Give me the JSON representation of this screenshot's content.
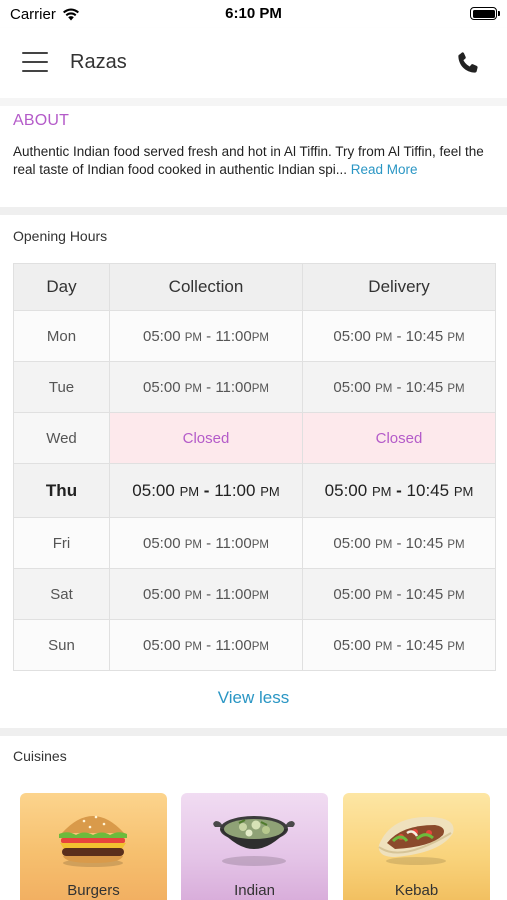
{
  "status_bar": {
    "carrier": "Carrier",
    "time": "6:10 PM"
  },
  "header": {
    "title": "Razas",
    "menu_icon": "hamburger-menu-icon",
    "phone_icon": "phone-icon"
  },
  "about": {
    "heading": "ABOUT",
    "text": "Authentic Indian food served fresh and hot in Al Tiffin. Try from Al Tiffin, feel the real taste of Indian food cooked in authentic Indian spi...",
    "read_more": "Read More"
  },
  "opening_hours": {
    "title": "Opening Hours",
    "headers": {
      "day": "Day",
      "collection": "Collection",
      "delivery": "Delivery"
    },
    "rows": [
      {
        "day": "Mon",
        "collection": {
          "open": "05:00",
          "open_ampm": "PM",
          "close": "11:00",
          "close_ampm": "PM"
        },
        "delivery": {
          "open": "05:00",
          "open_ampm": "PM",
          "close": "10:45",
          "close_ampm": "PM"
        }
      },
      {
        "day": "Tue",
        "collection": {
          "open": "05:00",
          "open_ampm": "PM",
          "close": "11:00",
          "close_ampm": "PM"
        },
        "delivery": {
          "open": "05:00",
          "open_ampm": "PM",
          "close": "10:45",
          "close_ampm": "PM"
        }
      },
      {
        "day": "Wed",
        "collection_closed": "Closed",
        "delivery_closed": "Closed"
      },
      {
        "day": "Thu",
        "collection": {
          "open": "05:00",
          "open_ampm": "PM",
          "close": "11:00",
          "close_ampm": "PM"
        },
        "delivery": {
          "open": "05:00",
          "open_ampm": "PM",
          "close": "10:45",
          "close_ampm": "PM"
        }
      },
      {
        "day": "Fri",
        "collection": {
          "open": "05:00",
          "open_ampm": "PM",
          "close": "11:00",
          "close_ampm": "PM"
        },
        "delivery": {
          "open": "05:00",
          "open_ampm": "PM",
          "close": "10:45",
          "close_ampm": "PM"
        }
      },
      {
        "day": "Sat",
        "collection": {
          "open": "05:00",
          "open_ampm": "PM",
          "close": "11:00",
          "close_ampm": "PM"
        },
        "delivery": {
          "open": "05:00",
          "open_ampm": "PM",
          "close": "10:45",
          "close_ampm": "PM"
        }
      },
      {
        "day": "Sun",
        "collection": {
          "open": "05:00",
          "open_ampm": "PM",
          "close": "11:00",
          "close_ampm": "PM"
        },
        "delivery": {
          "open": "05:00",
          "open_ampm": "PM",
          "close": "10:45",
          "close_ampm": "PM"
        }
      }
    ],
    "view_less": "View less"
  },
  "cuisines": {
    "title": "Cuisines",
    "items": [
      {
        "label": "Burgers",
        "icon": "burger-icon"
      },
      {
        "label": "Indian",
        "icon": "curry-bowl-icon"
      },
      {
        "label": "Kebab",
        "icon": "kebab-wrap-icon"
      }
    ]
  },
  "colors": {
    "accent_purple": "#b45bc9",
    "link_blue": "#2a96c4",
    "closed_bg": "#fde9ec"
  }
}
